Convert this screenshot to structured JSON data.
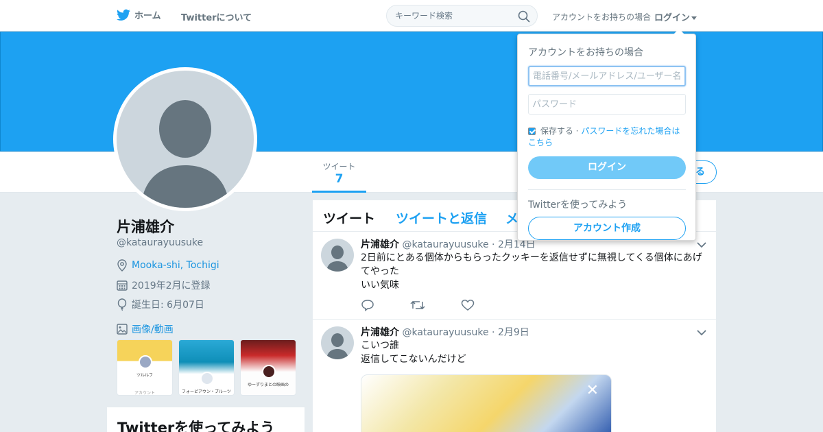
{
  "nav": {
    "home_label": "ホーム",
    "about_label": "Twitterについて",
    "search_placeholder": "キーワード検索",
    "login_prompt": "アカウントをお持ちの場合",
    "login_label": "ログイン"
  },
  "profile": {
    "name": "片浦雄介",
    "handle": "@kataurayuusuke",
    "location": "Mooka-shi, Tochigi",
    "joined": "2019年2月に登録",
    "birthday": "誕生日: 6月07日",
    "media_label": "画像/動画",
    "stats": {
      "tweets_label": "ツイート",
      "tweets_count": "7"
    },
    "follow_label": "る",
    "thumbnails": [
      {
        "name": "ツルルフ",
        "caption": "アカウント"
      },
      {
        "caption": "フォーピアウン・ブルーツ"
      },
      {
        "caption": "ゆーずりまとの映画の"
      }
    ]
  },
  "sidebar_card": {
    "title": "Twitterを使ってみよう"
  },
  "timeline": {
    "tabs": [
      "ツイート",
      "ツイートと返信",
      "メ"
    ],
    "tweets": [
      {
        "name": "片浦雄介",
        "handle": "@kataurayuusuke",
        "date": "2月14日",
        "lines": [
          "2日前にとある個体からもらったクッキーを返信せずに無視してくる個体にあげ",
          "てやった",
          "いい気味"
        ]
      },
      {
        "name": "片浦雄介",
        "handle": "@kataurayuusuke",
        "date": "2月9日",
        "lines": [
          "こいつ誰",
          "返信してこないんだけど"
        ]
      }
    ]
  },
  "login_dropdown": {
    "title": "アカウントをお持ちの場合",
    "phone_placeholder": "電話番号/メールアドレス/ユーザー名",
    "password_placeholder": "パスワード",
    "remember_label": "保存する",
    "separator": "·",
    "forgot_label": "パスワードを忘れた場合はこちら",
    "login_button": "ログイン",
    "try_label": "Twitterを使ってみよう",
    "signup_button": "アカウント作成"
  },
  "colors": {
    "brand": "#1da1f2",
    "header": "#1da1f2",
    "background": "#e6ecf0"
  }
}
